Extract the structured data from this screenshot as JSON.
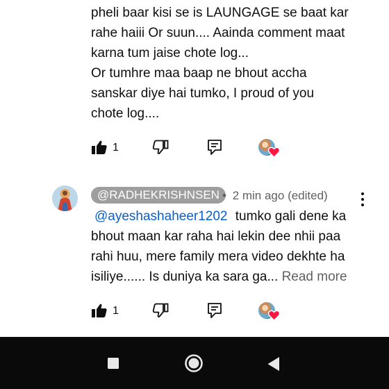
{
  "comment1": {
    "lines": [
      "pheli baar kisi se is LAUNGAGE se baat kar",
      "rahe haiii Or suun.... Aainda comment maat",
      "karna tum jaise chote log...",
      "Or tumhre maa baap ne bhout accha",
      "sanskar diye hai tumko, I proud of you",
      "chote log...."
    ],
    "like_count": "1"
  },
  "comment2": {
    "handle": "@RADHEKRISHNSEN",
    "separator": "•",
    "time": "2 min ago (edited)",
    "mention": "@ayeshashaheer1202",
    "first_line_rest": "tumko gali dene ka",
    "lines": [
      "bhout maan kar raha hai lekin dee nhii paa",
      "rahi huu, mere family mera video dekhte ha"
    ],
    "last_line": "isiliye...... Is duniya ka sara ga...",
    "read_more": "Read more",
    "like_count": "1"
  },
  "colors": {
    "chip_bg": "#9e9e9e",
    "mention": "#065fd4",
    "navbar": "#0a0a0a",
    "heart": "#ff1744"
  },
  "icons": {
    "like": "thumbs-up-filled-icon",
    "dislike": "thumbs-down-outline-icon",
    "reply": "reply-comment-icon",
    "heart": "creator-heart-icon",
    "more": "more-vertical-icon",
    "nav_recents": "square-icon",
    "nav_home": "circle-icon",
    "nav_back": "triangle-back-icon"
  }
}
